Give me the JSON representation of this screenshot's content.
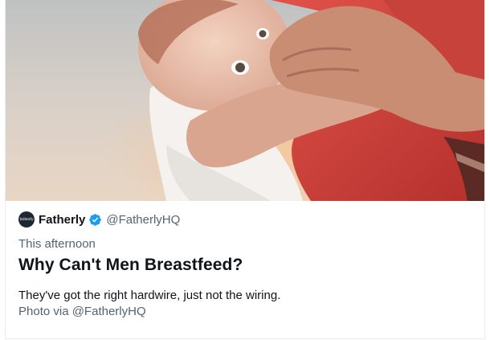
{
  "card": {
    "image": {
      "alt_icon": "photo-baby-being-held"
    },
    "author": {
      "avatar_text": "fatherly",
      "name": "Fatherly",
      "verified_icon": "verified-badge-icon",
      "handle": "@FatherlyHQ"
    },
    "time": "This afternoon",
    "headline": "Why Can't Men Breastfeed?",
    "description": "They've got the right hardwire, just not the wiring.",
    "photo_credit": "Photo via @FatherlyHQ"
  },
  "colors": {
    "verified": "#1d9bf0",
    "text_primary": "#0f1419",
    "text_secondary": "#536471",
    "border": "#e6ecf0"
  }
}
